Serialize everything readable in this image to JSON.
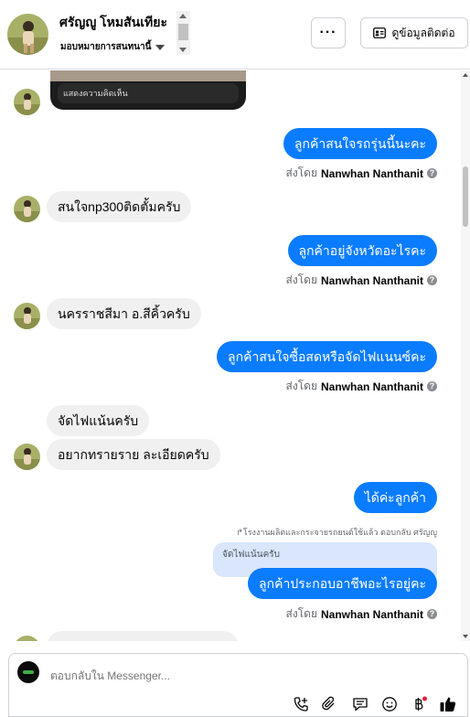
{
  "header": {
    "contact_name": "ศรัญญู โหมสันเทียะ",
    "assign_label": "มอบหมายการสนทนานี้",
    "more_label": "···",
    "contact_info_label": "ดูข้อมูลติดต่อ"
  },
  "thread": {
    "media_caption": "แสดงความคิดเห็น",
    "sent_by_prefix": "ส่งโดย",
    "agent_name": "Nanwhan Nanthanit",
    "messages": [
      {
        "dir": "out",
        "text": "ลูกค้าสนใจรถรุ่นนี้นะคะ"
      },
      {
        "dir": "in",
        "text": "สนใจnp300ติดตั้มครับ"
      },
      {
        "dir": "out",
        "text": "ลูกค้าอยู่จังหวัดอะไรคะ"
      },
      {
        "dir": "in",
        "text": "นครราชสีมา อ.สีคิ้วครับ"
      },
      {
        "dir": "out",
        "text": "ลูกค้าสนใจซื้อสดหรือจัดไฟแนนซ์คะ"
      },
      {
        "dir": "in",
        "text": "จัดไฟแน้นครับ"
      },
      {
        "dir": "in",
        "text": "อยากทรายราย ละเอียดครับ"
      },
      {
        "dir": "out",
        "text": "ได้ค่ะลูกค้า"
      },
      {
        "dir": "out",
        "text": "ลูกค้าประกอบอาชีพอะไรอยู่คะ"
      }
    ],
    "reply_meta": "↱โรงงานผลิตและกระจายรถยนต์ใช้แล้ว ตอบกลับ ศรัญญู",
    "reply_quote": "จัดไฟแน้นครับ"
  },
  "composer": {
    "placeholder": "ตอบกลับใน Messenger..."
  },
  "colors": {
    "outgoing_bubble": "#0a7cff",
    "incoming_bubble": "#f0f0f0",
    "reply_quote_bg": "#d9e6fb",
    "like_icon": "#050505"
  },
  "icons": [
    "more-icon",
    "contact-card-icon",
    "info-icon",
    "add-call-icon",
    "attach-icon",
    "saved-reply-icon",
    "emoji-icon",
    "baht-icon",
    "like-icon"
  ]
}
